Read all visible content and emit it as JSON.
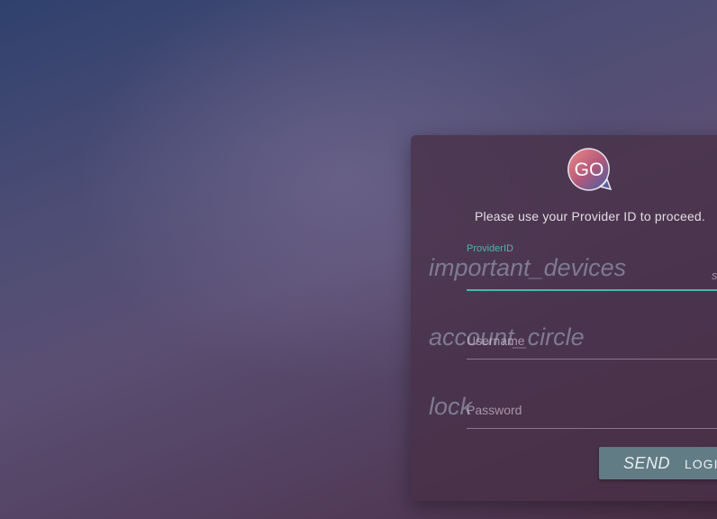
{
  "login": {
    "logo_text": "GO",
    "prompt": "Please use your Provider ID to proceed.",
    "provider": {
      "icon": "important_devices",
      "label": "ProviderID",
      "value": "",
      "suffix": "s"
    },
    "username": {
      "icon": "account_circle",
      "label": "Username",
      "value": ""
    },
    "password": {
      "icon": "lock",
      "label": "Password",
      "value": ""
    },
    "send_label": "SEND",
    "login_label": "LOGI"
  },
  "colors": {
    "accent": "#4db6ac",
    "button": "#617c85",
    "card": "#483046"
  }
}
